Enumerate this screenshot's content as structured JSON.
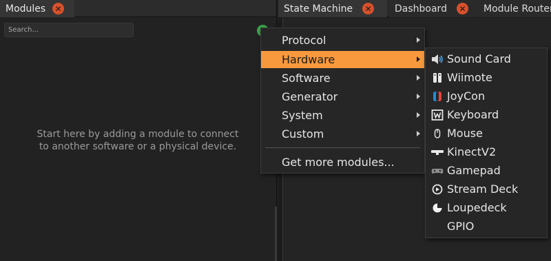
{
  "left_panel": {
    "tab_title": "Modules",
    "search_placeholder": "Search...",
    "empty_message_line1": "Start here by adding a module to connect",
    "empty_message_line2": "to another software or a physical device."
  },
  "right_panel": {
    "tabs": [
      {
        "label": "State Machine"
      },
      {
        "label": "Dashboard"
      },
      {
        "label": "Module Router"
      }
    ]
  },
  "menu": {
    "items": [
      {
        "label": "Protocol",
        "submenu": true
      },
      {
        "label": "Hardware",
        "submenu": true,
        "highlighted": true
      },
      {
        "label": "Software",
        "submenu": true
      },
      {
        "label": "Generator",
        "submenu": true
      },
      {
        "label": "System",
        "submenu": true
      },
      {
        "label": "Custom",
        "submenu": true
      }
    ],
    "footer_item": "Get more modules..."
  },
  "submenu": {
    "items": [
      {
        "label": "Sound Card",
        "icon": "speaker-icon"
      },
      {
        "label": "Wiimote",
        "icon": "wiimote-icon"
      },
      {
        "label": "JoyCon",
        "icon": "joycon-icon"
      },
      {
        "label": "Keyboard",
        "icon": "keyboard-icon"
      },
      {
        "label": "Mouse",
        "icon": "mouse-icon"
      },
      {
        "label": "KinectV2",
        "icon": "kinect-icon"
      },
      {
        "label": "Gamepad",
        "icon": "gamepad-icon"
      },
      {
        "label": "Stream Deck",
        "icon": "stream-deck-icon"
      },
      {
        "label": "Loupedeck",
        "icon": "loupedeck-icon"
      },
      {
        "label": "GPIO",
        "icon": ""
      }
    ]
  },
  "colors": {
    "highlight": "#f7993c",
    "close_button": "#d9502a",
    "add_button": "#3aa34a",
    "joycon_left": "#1e8fd9",
    "joycon_right": "#e8433c"
  }
}
